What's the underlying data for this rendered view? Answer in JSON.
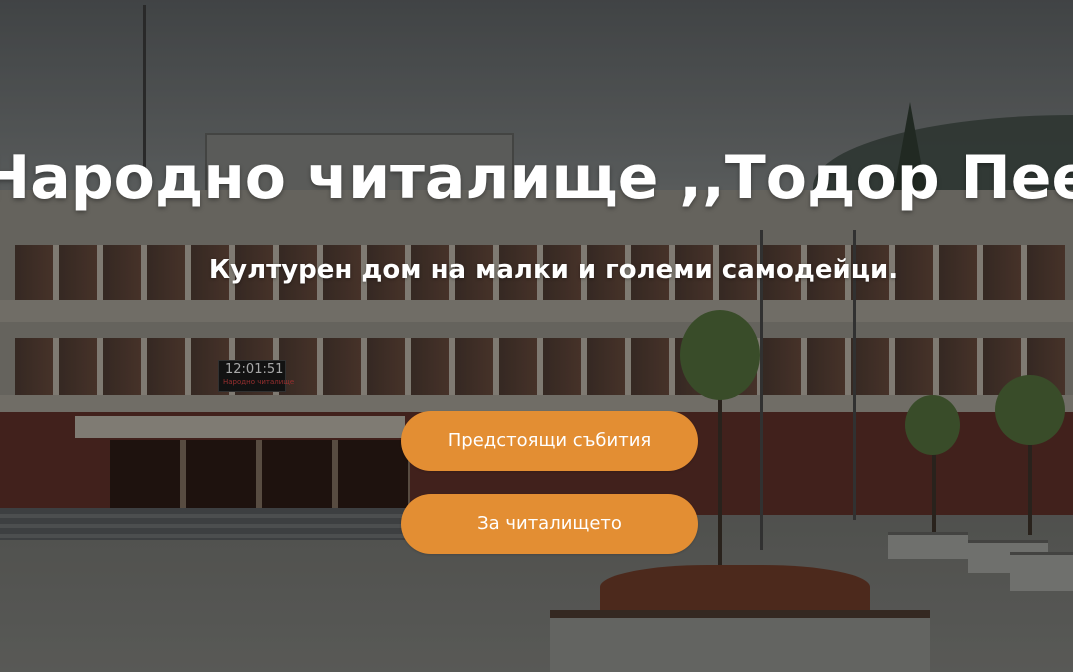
{
  "hero": {
    "title": "Народно читалище ,,Тодор Пеев\"",
    "subtitle": "Културен дом на малки и големи самодейци.",
    "background_clock": {
      "time": "12:01:51",
      "label": "Народно читалище"
    },
    "buttons": {
      "events_label": "Предстоящи събития",
      "about_label": "За читалището"
    }
  },
  "colors": {
    "button_bg": "#e38e33",
    "text": "#ffffff",
    "overlay": "rgba(0,0,0,0.28)"
  }
}
